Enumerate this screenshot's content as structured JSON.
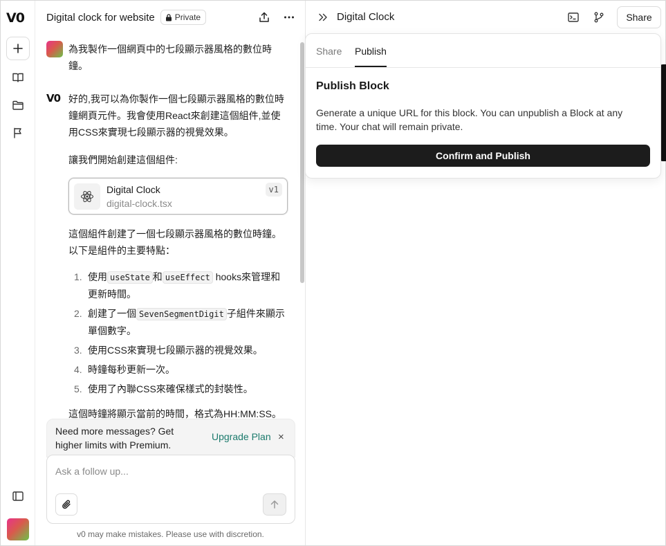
{
  "rail": {
    "logo": "V0",
    "icons": [
      "plus-icon",
      "book-icon",
      "folder-icon",
      "flag-icon",
      "sidebar-icon"
    ]
  },
  "chat": {
    "title": "Digital clock for website",
    "visibility": "Private",
    "user_message": "為我製作一個網頁中的七段顯示器風格的數位時鐘。",
    "ai_logo": "V0",
    "ai_intro": "好的,我可以為你製作一個七段顯示器風格的數位時鐘網頁元件。我會使用React來創建這個組件,並使用CSS來實現七段顯示器的視覺效果。",
    "ai_lead": "讓我們開始創建這個組件:",
    "file_card": {
      "title": "Digital Clock",
      "filename": "digital-clock.tsx",
      "version": "v1"
    },
    "ai_summary": "這個組件創建了一個七段顯示器風格的數位時鐘。以下是組件的主要特點：",
    "features": [
      {
        "num": "1.",
        "pre": "使用",
        "code1": "useState",
        "mid": "和",
        "code2": "useEffect",
        "post": " hooks來管理和更新時間。"
      },
      {
        "num": "2.",
        "pre": "創建了一個",
        "code1": "SevenSegmentDigit",
        "post": "子組件來顯示單個數字。"
      },
      {
        "num": "3.",
        "text": "使用CSS來實現七段顯示器的視覺效果。"
      },
      {
        "num": "4.",
        "text": "時鐘每秒更新一次。"
      },
      {
        "num": "5.",
        "text": "使用了內聯CSS來確保樣式的封裝性。"
      }
    ],
    "cut_line": "這個時鐘將顯示當前的時間，格式為HH:MM:SS。"
  },
  "upgrade": {
    "text": "Need more messages? Get higher limits with Premium.",
    "link": "Upgrade Plan",
    "close": "×"
  },
  "composer": {
    "placeholder": "Ask a follow up..."
  },
  "disclaimer": "v0 may make mistakes. Please use with discretion.",
  "right": {
    "title": "Digital Clock",
    "share_label": "Share",
    "tabs": [
      "Share",
      "Publish"
    ],
    "active_tab": "Publish",
    "popover_title": "Publish Block",
    "popover_desc": "Generate a unique URL for this block. You can unpublish a Block at any time. Your chat will remain private.",
    "confirm_label": "Confirm and Publish"
  }
}
